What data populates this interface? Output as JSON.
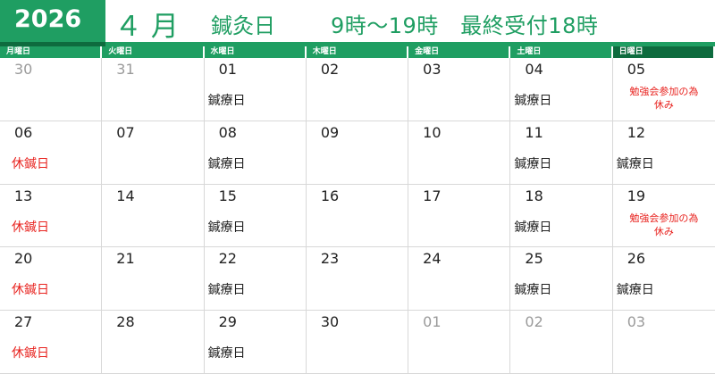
{
  "header": {
    "year": "2026",
    "month": "４ 月",
    "title": "鍼灸日",
    "hours": "9時～19時　最終受付18時"
  },
  "colors": {
    "primary_green": "#1f9e62",
    "dark_green": "#0e6b3e",
    "red_note": "#e8231f"
  },
  "weekdays": [
    "月曜日",
    "火曜日",
    "水曜日",
    "木曜日",
    "金曜日",
    "土曜日",
    "日曜日"
  ],
  "weeks": [
    [
      {
        "day": "30",
        "other": true,
        "note": "",
        "note_color": ""
      },
      {
        "day": "31",
        "other": true,
        "note": "",
        "note_color": ""
      },
      {
        "day": "01",
        "other": false,
        "note": "鍼療日",
        "note_color": "black"
      },
      {
        "day": "02",
        "other": false,
        "note": "",
        "note_color": ""
      },
      {
        "day": "03",
        "other": false,
        "note": "",
        "note_color": ""
      },
      {
        "day": "04",
        "other": false,
        "note": "鍼療日",
        "note_color": "black"
      },
      {
        "day": "05",
        "other": false,
        "note": "勉強会参加の為\n休み",
        "note_color": "small"
      }
    ],
    [
      {
        "day": "06",
        "other": false,
        "note": "休鍼日",
        "note_color": "red"
      },
      {
        "day": "07",
        "other": false,
        "note": "",
        "note_color": ""
      },
      {
        "day": "08",
        "other": false,
        "note": "鍼療日",
        "note_color": "black"
      },
      {
        "day": "09",
        "other": false,
        "note": "",
        "note_color": ""
      },
      {
        "day": "10",
        "other": false,
        "note": "",
        "note_color": ""
      },
      {
        "day": "11",
        "other": false,
        "note": "鍼療日",
        "note_color": "black"
      },
      {
        "day": "12",
        "other": false,
        "note": "鍼療日",
        "note_color": "black"
      }
    ],
    [
      {
        "day": "13",
        "other": false,
        "note": "休鍼日",
        "note_color": "red"
      },
      {
        "day": "14",
        "other": false,
        "note": "",
        "note_color": ""
      },
      {
        "day": "15",
        "other": false,
        "note": "鍼療日",
        "note_color": "black"
      },
      {
        "day": "16",
        "other": false,
        "note": "",
        "note_color": ""
      },
      {
        "day": "17",
        "other": false,
        "note": "",
        "note_color": ""
      },
      {
        "day": "18",
        "other": false,
        "note": "鍼療日",
        "note_color": "black"
      },
      {
        "day": "19",
        "other": false,
        "note": "勉強会参加の為\n休み",
        "note_color": "small"
      }
    ],
    [
      {
        "day": "20",
        "other": false,
        "note": "休鍼日",
        "note_color": "red"
      },
      {
        "day": "21",
        "other": false,
        "note": "",
        "note_color": ""
      },
      {
        "day": "22",
        "other": false,
        "note": "鍼療日",
        "note_color": "black"
      },
      {
        "day": "23",
        "other": false,
        "note": "",
        "note_color": ""
      },
      {
        "day": "24",
        "other": false,
        "note": "",
        "note_color": ""
      },
      {
        "day": "25",
        "other": false,
        "note": "鍼療日",
        "note_color": "black"
      },
      {
        "day": "26",
        "other": false,
        "note": "鍼療日",
        "note_color": "black"
      }
    ],
    [
      {
        "day": "27",
        "other": false,
        "note": "休鍼日",
        "note_color": "red"
      },
      {
        "day": "28",
        "other": false,
        "note": "",
        "note_color": ""
      },
      {
        "day": "29",
        "other": false,
        "note": "鍼療日",
        "note_color": "black"
      },
      {
        "day": "30",
        "other": false,
        "note": "",
        "note_color": ""
      },
      {
        "day": "01",
        "other": true,
        "note": "",
        "note_color": ""
      },
      {
        "day": "02",
        "other": true,
        "note": "",
        "note_color": ""
      },
      {
        "day": "03",
        "other": true,
        "note": "",
        "note_color": ""
      }
    ]
  ]
}
